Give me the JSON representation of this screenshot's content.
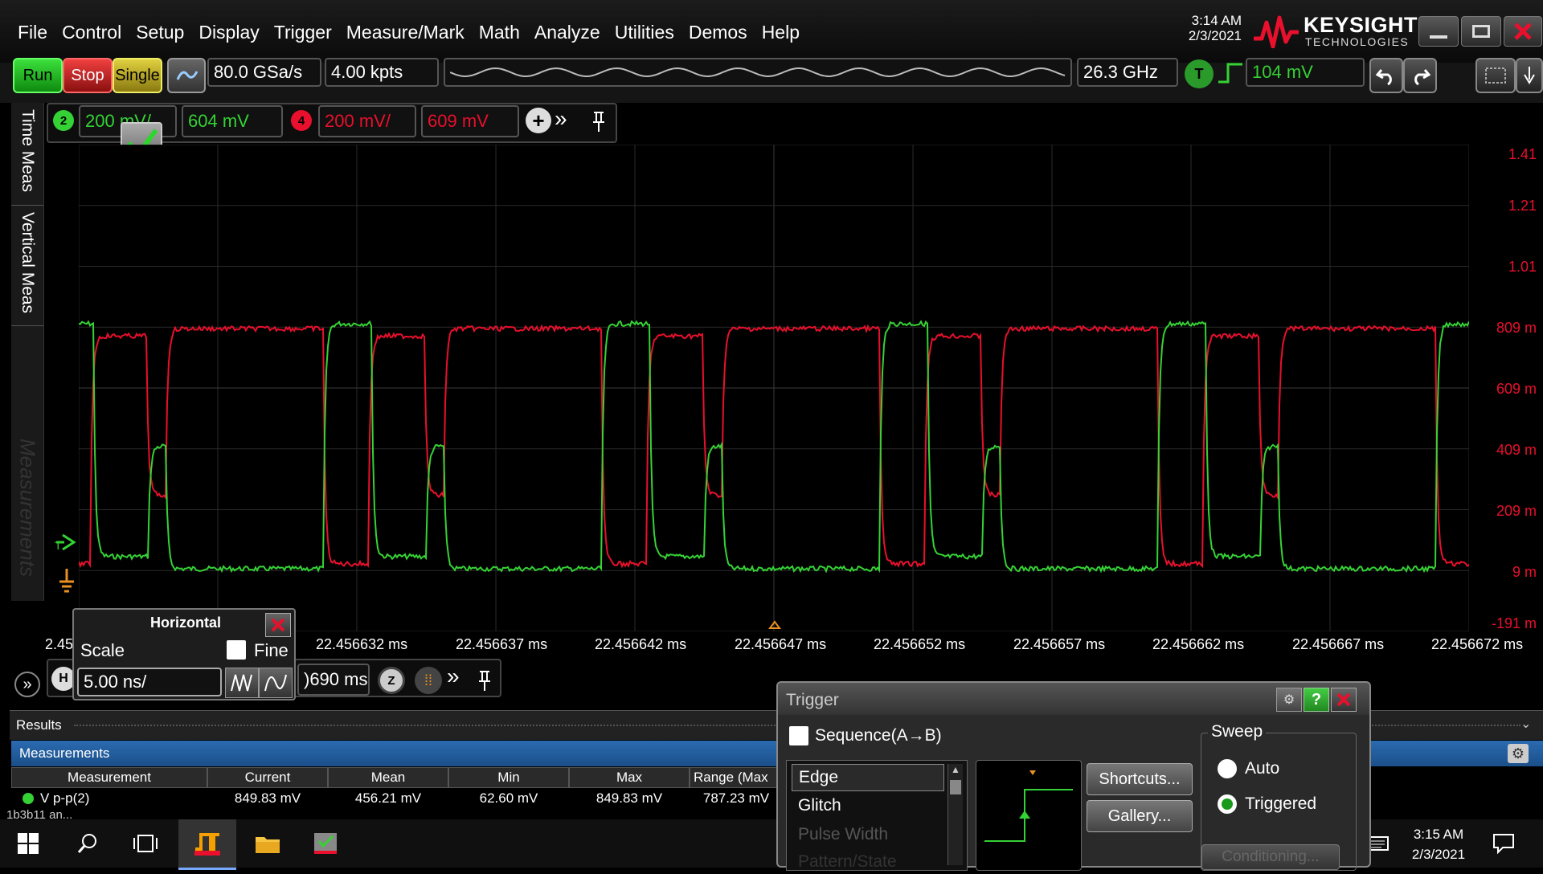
{
  "menu": [
    "File",
    "Control",
    "Setup",
    "Display",
    "Trigger",
    "Measure/Mark",
    "Math",
    "Analyze",
    "Utilities",
    "Demos",
    "Help"
  ],
  "clock_top": {
    "time": "3:14 AM",
    "date": "2/3/2021"
  },
  "brand": {
    "name": "KEYSIGHT",
    "sub": "TECHNOLOGIES"
  },
  "toolbar": {
    "run": "Run",
    "stop": "Stop",
    "single": "Single",
    "sample_rate": "80.0 GSa/s",
    "memory": "4.00 kpts",
    "bandwidth": "26.3 GHz",
    "trigger_badge": "T",
    "trigger_level": "104 mV"
  },
  "side_tabs": {
    "time": "Time Meas",
    "vertical": "Vertical Meas",
    "measurements": "Measurements"
  },
  "channels": [
    {
      "num": "2",
      "scale": "200 mV/",
      "offset": "604 mV",
      "color": "#35d235"
    },
    {
      "num": "4",
      "scale": "200 mV/",
      "offset": "609 mV",
      "color": "#e8102c"
    }
  ],
  "volt_labels": [
    "1.41",
    "1.21",
    "1.01",
    "809 m",
    "609 m",
    "409 m",
    "209 m",
    "9 m",
    "-191 m"
  ],
  "time_labels": [
    "2.45",
    "22.456632 ms",
    "22.456637 ms",
    "22.456642 ms",
    "22.456647 ms",
    "22.456652 ms",
    "22.456657 ms",
    "22.456662 ms",
    "22.456667 ms",
    "22.456672 ms"
  ],
  "horizontal": {
    "title": "Horizontal",
    "scale_label": "Scale",
    "fine_label": "Fine",
    "scale_value": "5.00 ns/",
    "position": ")690 ms",
    "h_badge": "H"
  },
  "results": {
    "label": "Results"
  },
  "measurements": {
    "label": "Measurements",
    "columns": [
      "Measurement",
      "Current",
      "Mean",
      "Min",
      "Max",
      "Range (Max"
    ],
    "row": {
      "name": "V p-p(2)",
      "current": "849.83 mV",
      "mean": "456.21 mV",
      "min": "62.60 mV",
      "max": "849.83 mV",
      "range": "787.23 mV"
    },
    "cut_text": "1b3b11 an..."
  },
  "trigger_dialog": {
    "title": "Trigger",
    "sequence": "Sequence(A→B)",
    "types": [
      "Edge",
      "Glitch",
      "Pulse Width",
      "Pattern/State"
    ],
    "shortcuts": "Shortcuts...",
    "gallery": "Gallery...",
    "conditioning": "Conditioning...",
    "sweep_title": "Sweep",
    "auto": "Auto",
    "triggered": "Triggered"
  },
  "taskbar": {
    "time": "3:15 AM",
    "date": "2/3/2021"
  },
  "colors": {
    "ch2": "#35d235",
    "ch4": "#e8102c",
    "accent": "#2b6bb0"
  }
}
